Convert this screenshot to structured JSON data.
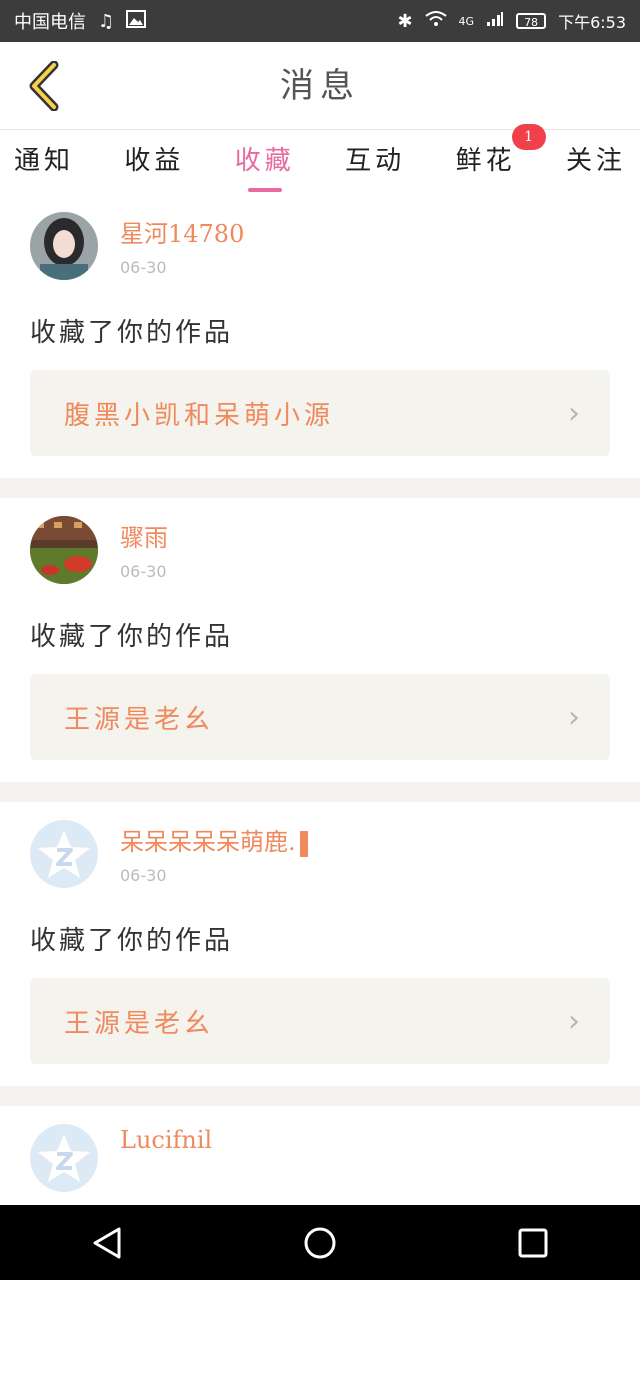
{
  "status_bar": {
    "carrier": "中国电信",
    "time": "下午6:53",
    "battery": "78",
    "network": "4G"
  },
  "header": {
    "title": "消息"
  },
  "tabs": [
    {
      "label": "通知",
      "active": false
    },
    {
      "label": "收益",
      "active": false
    },
    {
      "label": "收藏",
      "active": true
    },
    {
      "label": "互动",
      "active": false
    },
    {
      "label": "鲜花",
      "active": false,
      "badge": "1"
    },
    {
      "label": "关注",
      "active": false
    }
  ],
  "messages": [
    {
      "username": "星河14780",
      "date": "06-30",
      "action": "收藏了你的作品",
      "work_title": "腹黑小凯和呆萌小源",
      "avatar": "photo-avatar-girl"
    },
    {
      "username": "骤雨",
      "date": "06-30",
      "action": "收藏了你的作品",
      "work_title": "王源是老幺",
      "avatar": "photo-avatar-scene"
    },
    {
      "username": "呆呆呆呆呆萌鹿.",
      "date": "06-30",
      "action": "收藏了你的作品",
      "work_title": "王源是老幺",
      "avatar": "default-star-avatar"
    },
    {
      "username": "Lucifnil",
      "date": "",
      "action": "",
      "work_title": "",
      "avatar": "default-star-avatar"
    }
  ],
  "colors": {
    "accent_pink": "#e86aa0",
    "name_orange": "#f08a5d",
    "badge_red": "#f0404a",
    "box_bg": "#f4f3ee"
  }
}
